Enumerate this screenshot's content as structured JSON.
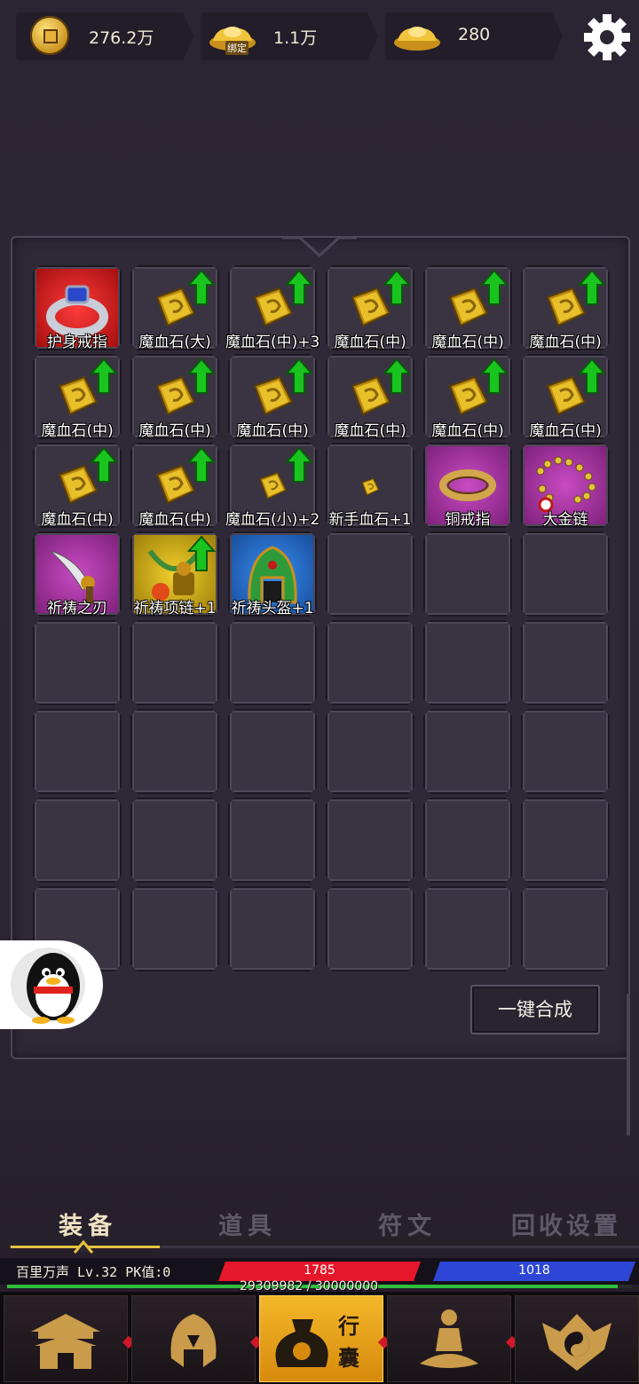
{
  "currency": {
    "copper": "276.2万",
    "bound_gold": "1.1万",
    "bound_tag": "绑定",
    "gold": "280"
  },
  "inventory": {
    "items": [
      {
        "label": "护身戒指",
        "rarity": "red",
        "icon": "ring-icon",
        "upgrade": false
      },
      {
        "label": "魔血石(大)",
        "rarity": "normal",
        "icon": "blood-stone-icon",
        "upgrade": true
      },
      {
        "label": "魔血石(中)+3",
        "rarity": "normal",
        "icon": "blood-stone-icon",
        "upgrade": true
      },
      {
        "label": "魔血石(中)",
        "rarity": "normal",
        "icon": "blood-stone-icon",
        "upgrade": true
      },
      {
        "label": "魔血石(中)",
        "rarity": "normal",
        "icon": "blood-stone-icon",
        "upgrade": true
      },
      {
        "label": "魔血石(中)",
        "rarity": "normal",
        "icon": "blood-stone-icon",
        "upgrade": true
      },
      {
        "label": "魔血石(中)",
        "rarity": "normal",
        "icon": "blood-stone-icon",
        "upgrade": true
      },
      {
        "label": "魔血石(中)",
        "rarity": "normal",
        "icon": "blood-stone-icon",
        "upgrade": true
      },
      {
        "label": "魔血石(中)",
        "rarity": "normal",
        "icon": "blood-stone-icon",
        "upgrade": true
      },
      {
        "label": "魔血石(中)",
        "rarity": "normal",
        "icon": "blood-stone-icon",
        "upgrade": true
      },
      {
        "label": "魔血石(中)",
        "rarity": "normal",
        "icon": "blood-stone-icon",
        "upgrade": true
      },
      {
        "label": "魔血石(中)",
        "rarity": "normal",
        "icon": "blood-stone-icon",
        "upgrade": true
      },
      {
        "label": "魔血石(中)",
        "rarity": "normal",
        "icon": "blood-stone-icon",
        "upgrade": true
      },
      {
        "label": "魔血石(中)",
        "rarity": "normal",
        "icon": "blood-stone-icon",
        "upgrade": true
      },
      {
        "label": "魔血石(小)+2",
        "rarity": "normal",
        "icon": "blood-stone-small-icon",
        "upgrade": true
      },
      {
        "label": "新手血石+1",
        "rarity": "normal",
        "icon": "novice-blood-stone-icon",
        "upgrade": false
      },
      {
        "label": "铜戒指",
        "rarity": "purple",
        "icon": "bronze-ring-icon",
        "upgrade": false
      },
      {
        "label": "大金链",
        "rarity": "purple",
        "icon": "gold-chain-icon",
        "upgrade": false
      },
      {
        "label": "祈祷之刃",
        "rarity": "purple",
        "icon": "prayer-blade-icon",
        "upgrade": false
      },
      {
        "label": "祈祷项链+1",
        "rarity": "yellow",
        "icon": "prayer-necklace-icon",
        "upgrade": true
      },
      {
        "label": "祈祷头盔+1",
        "rarity": "blue",
        "icon": "prayer-helmet-icon",
        "upgrade": false
      }
    ],
    "merge_button": "一键合成"
  },
  "tabs": [
    {
      "label": "装备",
      "active": true
    },
    {
      "label": "道具",
      "active": false
    },
    {
      "label": "符文",
      "active": false
    },
    {
      "label": "回收设置",
      "active": false
    }
  ],
  "player": {
    "name_line": "百里万声  Lv.32 PK值:0",
    "hp": "1785",
    "mp": "1018",
    "exp_text": "29309982 / 30000000",
    "exp_fraction": 0.977
  },
  "nav": {
    "active_label_1": "行",
    "active_label_2": "囊",
    "items": [
      "city-gate-icon",
      "helmet-icon",
      "bag-icon",
      "meditation-icon",
      "taiji-icon"
    ]
  },
  "colors": {
    "hp": "#e6172a",
    "mp": "#2d46d6",
    "exp": "#2fbf3d",
    "active_tab_underline": "#e7c23f"
  }
}
